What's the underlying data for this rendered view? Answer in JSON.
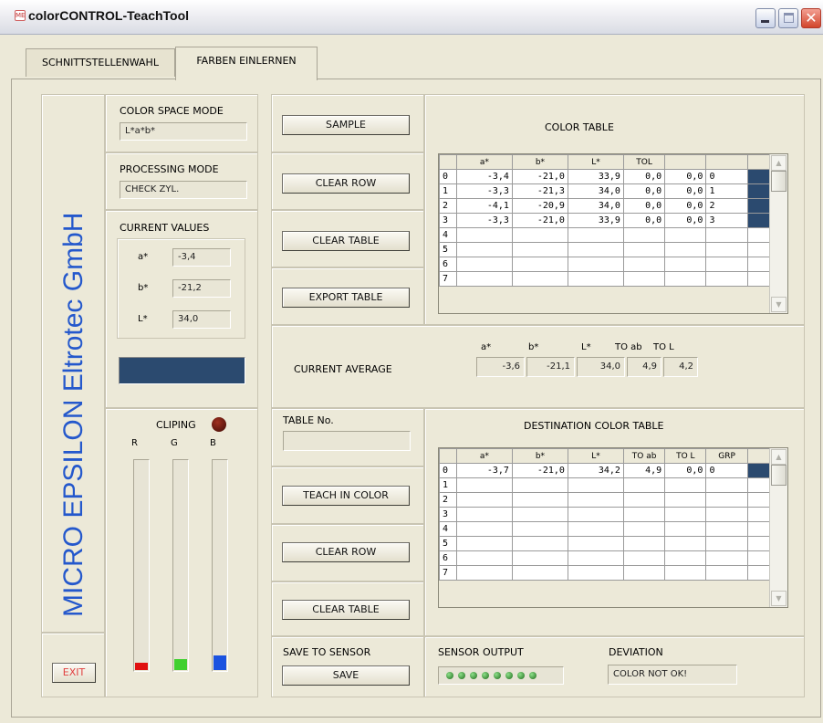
{
  "window": {
    "title": "colorCONTROL-TeachTool",
    "app_icon": "app-logo-icon"
  },
  "tabs": [
    {
      "label": "SCHNITTSTELLENWAHL",
      "active": false
    },
    {
      "label": "FARBEN EINLERNEN",
      "active": true
    }
  ],
  "brand": {
    "text": "MICRO EPSILON Eltrotec GmbH",
    "color": "#2458cc"
  },
  "left": {
    "color_space_mode": {
      "label": "COLOR SPACE MODE",
      "value": "L*a*b*"
    },
    "processing_mode": {
      "label": "PROCESSING MODE",
      "value": "CHECK ZYL."
    },
    "current_values": {
      "label": "CURRENT VALUES",
      "a_label": "a*",
      "a_value": "-3,4",
      "b_label": "b*",
      "b_value": "-21,2",
      "l_label": "L*",
      "l_value": "34,0"
    },
    "color_swatch": "#2b4a6f",
    "clipping": {
      "label": "CLIPING",
      "r": "R",
      "g": "G",
      "b": "B"
    },
    "exit_label": "EXIT"
  },
  "buttons": {
    "sample": "SAMPLE",
    "clear_row": "CLEAR ROW",
    "clear_table": "CLEAR TABLE",
    "export_table": "EXPORT TABLE",
    "teach_in_color": "TEACH IN COLOR",
    "clear_row_2": "CLEAR ROW",
    "clear_table_2": "CLEAR TABLE",
    "save": "SAVE"
  },
  "color_table": {
    "title": "COLOR TABLE",
    "headers": [
      "a*",
      "b*",
      "L*",
      "TOL",
      "",
      "",
      ""
    ],
    "rows": [
      {
        "idx": "0",
        "cells": [
          "-3,4",
          "-21,0",
          "33,9",
          "0,0",
          "0,0",
          "0"
        ],
        "selected": true
      },
      {
        "idx": "1",
        "cells": [
          "-3,3",
          "-21,3",
          "34,0",
          "0,0",
          "0,0",
          "1"
        ],
        "selected": true
      },
      {
        "idx": "2",
        "cells": [
          "-4,1",
          "-20,9",
          "34,0",
          "0,0",
          "0,0",
          "2"
        ],
        "selected": true
      },
      {
        "idx": "3",
        "cells": [
          "-3,3",
          "-21,0",
          "33,9",
          "0,0",
          "0,0",
          "3"
        ],
        "selected": true
      },
      {
        "idx": "4",
        "cells": [
          "",
          "",
          "",
          "",
          "",
          ""
        ],
        "selected": false
      },
      {
        "idx": "5",
        "cells": [
          "",
          "",
          "",
          "",
          "",
          ""
        ],
        "selected": false
      },
      {
        "idx": "6",
        "cells": [
          "",
          "",
          "",
          "",
          "",
          ""
        ],
        "selected": false
      },
      {
        "idx": "7",
        "cells": [
          "",
          "",
          "",
          "",
          "",
          ""
        ],
        "selected": false
      }
    ]
  },
  "current_average": {
    "label": "CURRENT AVERAGE",
    "headers": [
      "a*",
      "b*",
      "L*",
      "TO ab",
      "TO L"
    ],
    "values": [
      "-3,6",
      "-21,1",
      "34,0",
      "4,9",
      "4,2"
    ]
  },
  "table_no": {
    "label": "TABLE No.",
    "value": ""
  },
  "destination_table": {
    "title": "DESTINATION COLOR TABLE",
    "headers": [
      "a*",
      "b*",
      "L*",
      "TO ab",
      "TO L",
      "GRP",
      ""
    ],
    "rows": [
      {
        "idx": "0",
        "cells": [
          "-3,7",
          "-21,0",
          "34,2",
          "4,9",
          "0,0",
          "0"
        ],
        "selected": true
      },
      {
        "idx": "1",
        "cells": [
          "",
          "",
          "",
          "",
          "",
          ""
        ],
        "selected": false
      },
      {
        "idx": "2",
        "cells": [
          "",
          "",
          "",
          "",
          "",
          ""
        ],
        "selected": false
      },
      {
        "idx": "3",
        "cells": [
          "",
          "",
          "",
          "",
          "",
          ""
        ],
        "selected": false
      },
      {
        "idx": "4",
        "cells": [
          "",
          "",
          "",
          "",
          "",
          ""
        ],
        "selected": false
      },
      {
        "idx": "5",
        "cells": [
          "",
          "",
          "",
          "",
          "",
          ""
        ],
        "selected": false
      },
      {
        "idx": "6",
        "cells": [
          "",
          "",
          "",
          "",
          "",
          ""
        ],
        "selected": false
      },
      {
        "idx": "7",
        "cells": [
          "",
          "",
          "",
          "",
          "",
          ""
        ],
        "selected": false
      }
    ]
  },
  "save_to_sensor": {
    "label": "SAVE TO SENSOR"
  },
  "sensor_output": {
    "label": "SENSOR OUTPUT",
    "leds": 8,
    "led_color": "#2e8a2a"
  },
  "deviation": {
    "label": "DEVIATION",
    "value": "COLOR NOT OK!"
  }
}
